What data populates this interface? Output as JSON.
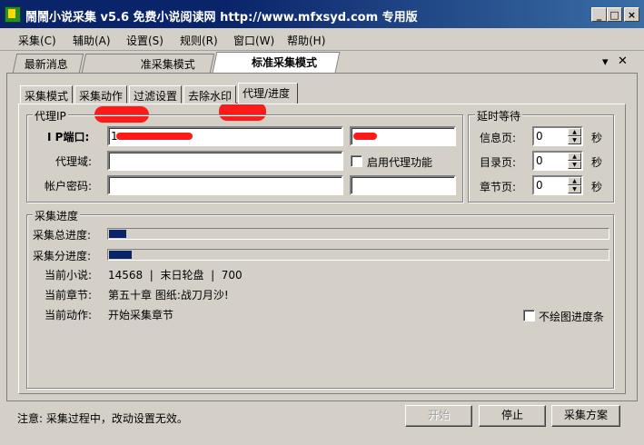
{
  "window": {
    "title": "鬧鬧小说采集 v5.6 免费小说阅读网 http://www.mfxsyd.com 专用版",
    "min_glyph": "_",
    "max_glyph": "□",
    "close_glyph": "×"
  },
  "menu": [
    "采集(C)",
    "辅助(A)",
    "设置(S)",
    "规则(R)",
    "窗口(W)",
    "帮助(H)"
  ],
  "doc_tabs": [
    {
      "label": "最新消息"
    },
    {
      "label": "准采集模式"
    },
    {
      "label": "标准采集模式"
    }
  ],
  "doc_tab_controls": {
    "dropdown": "▾",
    "close": "✕"
  },
  "sub_tabs": [
    "采集模式",
    "采集动作",
    "过滤设置",
    "去除水印",
    "代理/进度"
  ],
  "proxy": {
    "group_title": "代理IP",
    "ip_port_label": "I P端口:",
    "ip_value_visible": "1",
    "domain_label": "代理域:",
    "account_label": "帐户密码:",
    "enable_proxy_label": "启用代理功能",
    "enable_proxy_checked": false
  },
  "delay": {
    "group_title": "延时等待",
    "rows": [
      {
        "label": "信息页:",
        "value": "0",
        "unit": "秒"
      },
      {
        "label": "目录页:",
        "value": "0",
        "unit": "秒"
      },
      {
        "label": "章节页:",
        "value": "0",
        "unit": "秒"
      }
    ]
  },
  "progress": {
    "group_title": "采集进度",
    "total_label": "采集总进度:",
    "total_fraction": 0.035,
    "sub_label": "采集分进度:",
    "sub_fraction": 0.045,
    "current_novel_label": "当前小说:",
    "current_novel_value": "14568  |  末日轮盘  |  700",
    "current_chapter_label": "当前章节:",
    "current_chapter_value": "第五十章 图纸:战刀月沙!",
    "current_action_label": "当前动作:",
    "current_action_value": "开始采集章节",
    "no_draw_label": "不绘图进度条",
    "no_draw_checked": false
  },
  "footer": {
    "note": "注意: 采集过程中，改动设置无效。",
    "start_button": "开始",
    "stop_button": "停止",
    "plan_button": "采集方案"
  }
}
